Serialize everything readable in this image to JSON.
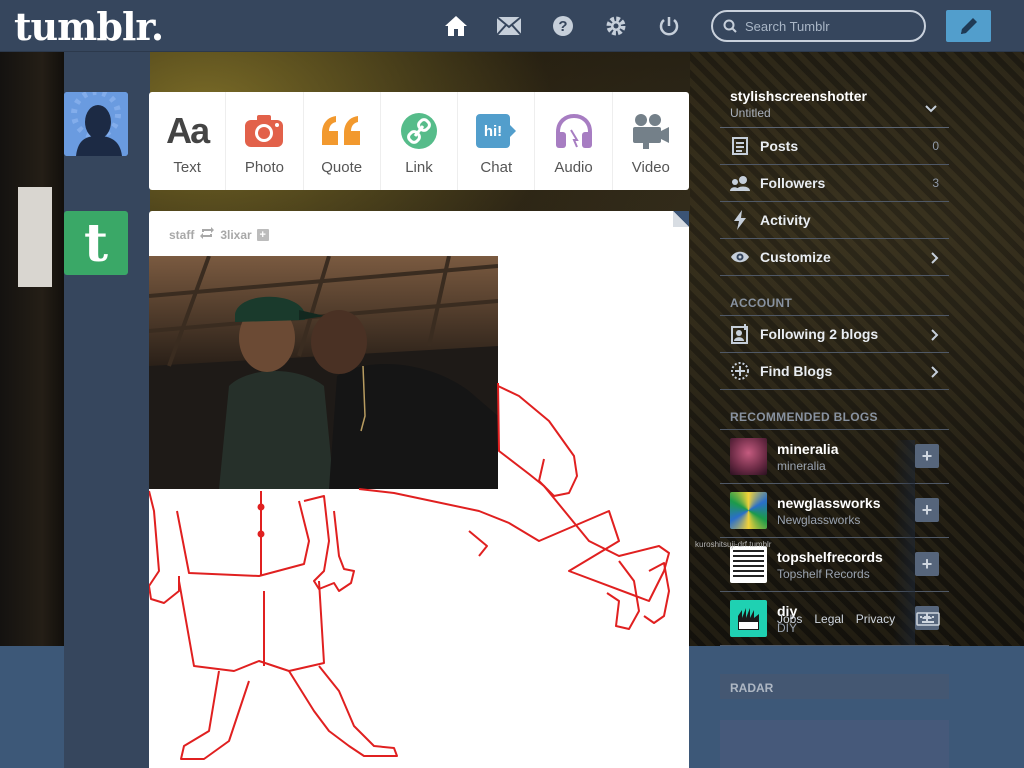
{
  "header": {
    "logo": "tumblr.",
    "search_placeholder": "Search Tumblr"
  },
  "nav_icons": [
    "home-icon",
    "mail-icon",
    "help-icon",
    "gear-icon",
    "power-icon",
    "pencil-icon"
  ],
  "post_types": [
    {
      "label": "Text",
      "icon": "text-icon",
      "color": "#444444"
    },
    {
      "label": "Photo",
      "icon": "camera-icon",
      "color": "#e2614a"
    },
    {
      "label": "Quote",
      "icon": "quote-icon",
      "color": "#f2992e"
    },
    {
      "label": "Link",
      "icon": "link-icon",
      "color": "#56bc8a"
    },
    {
      "label": "Chat",
      "icon": "chat-icon",
      "color": "#529ecc"
    },
    {
      "label": "Audio",
      "icon": "headphones-icon",
      "color": "#a77dc2"
    },
    {
      "label": "Video",
      "icon": "video-camera-icon",
      "color": "#748089"
    }
  ],
  "post": {
    "author": "staff",
    "reblogged_from": "3lixar"
  },
  "sidebar": {
    "blog_name": "stylishscreenshotter",
    "blog_subtitle": "Untitled",
    "rows": [
      {
        "label": "Posts",
        "count": "0",
        "icon": "posts-icon"
      },
      {
        "label": "Followers",
        "count": "3",
        "icon": "followers-icon"
      },
      {
        "label": "Activity",
        "count": "",
        "icon": "lightning-icon"
      },
      {
        "label": "Customize",
        "count": "",
        "icon": "eye-icon"
      }
    ],
    "account_title": "ACCOUNT",
    "account_rows": [
      {
        "label": "Following 2 blogs",
        "icon": "following-icon"
      },
      {
        "label": "Find Blogs",
        "icon": "find-blogs-icon"
      }
    ],
    "recommended_title": "RECOMMENDED BLOGS",
    "recommended": [
      {
        "name": "mineralia",
        "sub": "mineralia",
        "thumb_color": "#8a3c5c"
      },
      {
        "name": "newglassworks",
        "sub": "Newglassworks",
        "thumb_color": "#3f7db5"
      },
      {
        "name": "topshelfrecords",
        "sub": "Topshelf Records",
        "thumb_color": "#efefef"
      },
      {
        "name": "diy",
        "sub": "DIY",
        "thumb_color": "#1fd1b2"
      }
    ],
    "radar_title": "RADAR"
  },
  "footer": {
    "links": [
      "Jobs",
      "Legal",
      "Privacy"
    ]
  },
  "credit": "kuroshitsuji-drf.tumblr"
}
